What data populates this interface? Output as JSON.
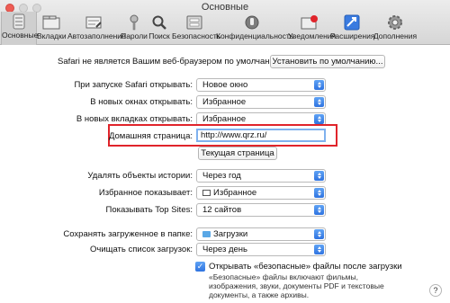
{
  "window": {
    "title": "Основные"
  },
  "toolbar": {
    "items": [
      {
        "label": "Основные",
        "icon": "switch-icon"
      },
      {
        "label": "Вкладки",
        "icon": "tabs-icon"
      },
      {
        "label": "Автозаполнение",
        "icon": "autofill-icon"
      },
      {
        "label": "Пароли",
        "icon": "key-icon"
      },
      {
        "label": "Поиск",
        "icon": "magnifier-icon"
      },
      {
        "label": "Безопасность",
        "icon": "shield-icon"
      },
      {
        "label": "Конфиденциальность",
        "icon": "hand-icon"
      },
      {
        "label": "Уведомления",
        "icon": "notifications-icon"
      },
      {
        "label": "Расширения",
        "icon": "extensions-icon"
      },
      {
        "label": "Дополнения",
        "icon": "gear-icon"
      }
    ]
  },
  "default_browser": {
    "text": "Safari не является Вашим веб-браузером по умолчанию.",
    "button": "Установить по умолчанию..."
  },
  "rows": {
    "safari_opens_with": {
      "label": "При запуске Safari открывать:",
      "value": "Новое окно"
    },
    "new_windows_open_with": {
      "label": "В новых окнах открывать:",
      "value": "Избранное"
    },
    "new_tabs_open_with": {
      "label": "В новых вкладках открывать:",
      "value": "Избранное"
    },
    "homepage": {
      "label": "Домашняя страница:",
      "value": "http://www.qrz.ru/",
      "button": "Текущая страница"
    },
    "remove_history": {
      "label": "Удалять объекты истории:",
      "value": "Через год"
    },
    "favorites_shows": {
      "label": "Избранное показывает:",
      "value": "Избранное"
    },
    "top_sites": {
      "label": "Показывать Top Sites:",
      "value": "12 сайтов"
    },
    "save_downloads": {
      "label": "Сохранять загруженное в папке:",
      "value": "Загрузки"
    },
    "clear_downloads": {
      "label": "Очищать список загрузок:",
      "value": "Через день"
    }
  },
  "safe_files": {
    "checkbox_label": "Открывать «безопасные» файлы после загрузки",
    "checked": true,
    "description": "«Безопасные» файлы включают фильмы, изображения, звуки, документы PDF и текстовые документы, а также архивы."
  },
  "help": "?",
  "colors": {
    "accent": "#2f73e0",
    "highlight": "#e0242b",
    "close": "#ee5c54"
  }
}
